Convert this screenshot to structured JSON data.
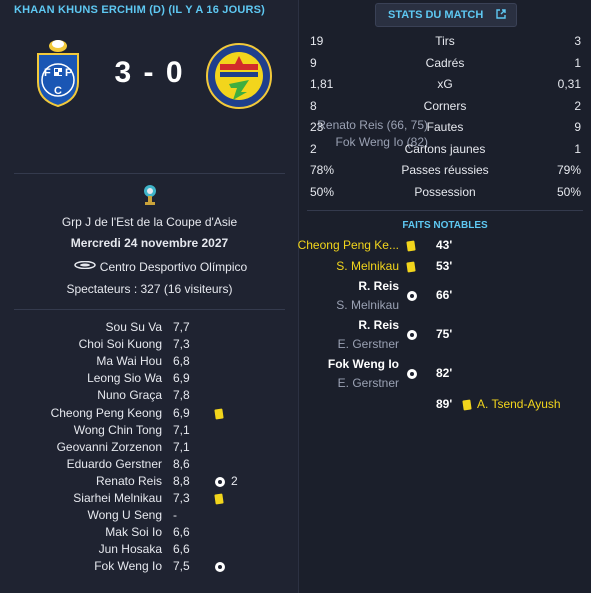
{
  "match": {
    "title": "KHAAN KHUNS ERCHIM (D) (IL Y A 16 JOURS)",
    "score": "3 - 0",
    "scorers": [
      "Renato Reis (66, 75)",
      "Fok Weng Io (82)"
    ]
  },
  "competition": {
    "name": "Grp J de l'Est de la Coupe d'Asie",
    "date": "Mercredi 24 novembre 2027",
    "stadium": "Centro Desportivo Olímpico",
    "attendance": "Spectateurs : 327 (16 visiteurs)"
  },
  "players": [
    {
      "name": "Sou Su Va",
      "rating": "7,7",
      "event": "",
      "count": ""
    },
    {
      "name": "Choi Soi Kuong",
      "rating": "7,3",
      "event": "",
      "count": ""
    },
    {
      "name": "Ma Wai Hou",
      "rating": "6,8",
      "event": "",
      "count": ""
    },
    {
      "name": "Leong Sio Wa",
      "rating": "6,9",
      "event": "",
      "count": ""
    },
    {
      "name": "Nuno Graça",
      "rating": "7,8",
      "event": "",
      "count": ""
    },
    {
      "name": "Cheong Peng Keong",
      "rating": "6,9",
      "event": "yellow-card",
      "count": ""
    },
    {
      "name": "Wong Chin Tong",
      "rating": "7,1",
      "event": "",
      "count": ""
    },
    {
      "name": "Geovanni Zorzenon",
      "rating": "7,1",
      "event": "",
      "count": ""
    },
    {
      "name": "Eduardo Gerstner",
      "rating": "8,6",
      "event": "",
      "count": ""
    },
    {
      "name": "Renato Reis",
      "rating": "8,8",
      "event": "goal",
      "count": "2"
    },
    {
      "name": "Siarhei Melnikau",
      "rating": "7,3",
      "event": "yellow-card",
      "count": ""
    },
    {
      "name": "Wong U Seng",
      "rating": "-",
      "event": "",
      "count": ""
    },
    {
      "name": "Mak Soi Io",
      "rating": "6,6",
      "event": "",
      "count": ""
    },
    {
      "name": "Jun Hosaka",
      "rating": "6,6",
      "event": "",
      "count": ""
    },
    {
      "name": "Fok Weng Io",
      "rating": "7,5",
      "event": "goal",
      "count": ""
    }
  ],
  "stats": {
    "button_label": "STATS DU MATCH",
    "rows": [
      {
        "label": "Tirs",
        "home": "19",
        "away": "3"
      },
      {
        "label": "Cadrés",
        "home": "9",
        "away": "1"
      },
      {
        "label": "xG",
        "home": "1,81",
        "away": "0,31"
      },
      {
        "label": "Corners",
        "home": "8",
        "away": "2"
      },
      {
        "label": "Fautes",
        "home": "23",
        "away": "9"
      },
      {
        "label": "Cartons jaunes",
        "home": "2",
        "away": "1"
      },
      {
        "label": "Passes réussies",
        "home": "78%",
        "away": "79%"
      },
      {
        "label": "Possession",
        "home": "50%",
        "away": "50%"
      }
    ]
  },
  "notable": {
    "title": "FAITS NOTABLES",
    "events": [
      {
        "type": "yellow",
        "player": "Cheong Peng Ke...",
        "assist": "",
        "minute": "43'"
      },
      {
        "type": "yellow",
        "player": "S. Melnikau",
        "assist": "",
        "minute": "53'"
      },
      {
        "type": "goal",
        "player": "R. Reis",
        "assist": "S. Melnikau",
        "minute": "66'"
      },
      {
        "type": "goal",
        "player": "R. Reis",
        "assist": "E. Gerstner",
        "minute": "75'"
      },
      {
        "type": "goal",
        "player": "Fok Weng Io",
        "assist": "E. Gerstner",
        "minute": "82'"
      },
      {
        "type": "away-yellow",
        "player": "A. Tsend-Ayush",
        "assist": "",
        "minute": "89'"
      }
    ]
  },
  "colors": {
    "accent": "#5ec8f2",
    "yellow": "#f2d51c",
    "background": "#1e2230"
  }
}
